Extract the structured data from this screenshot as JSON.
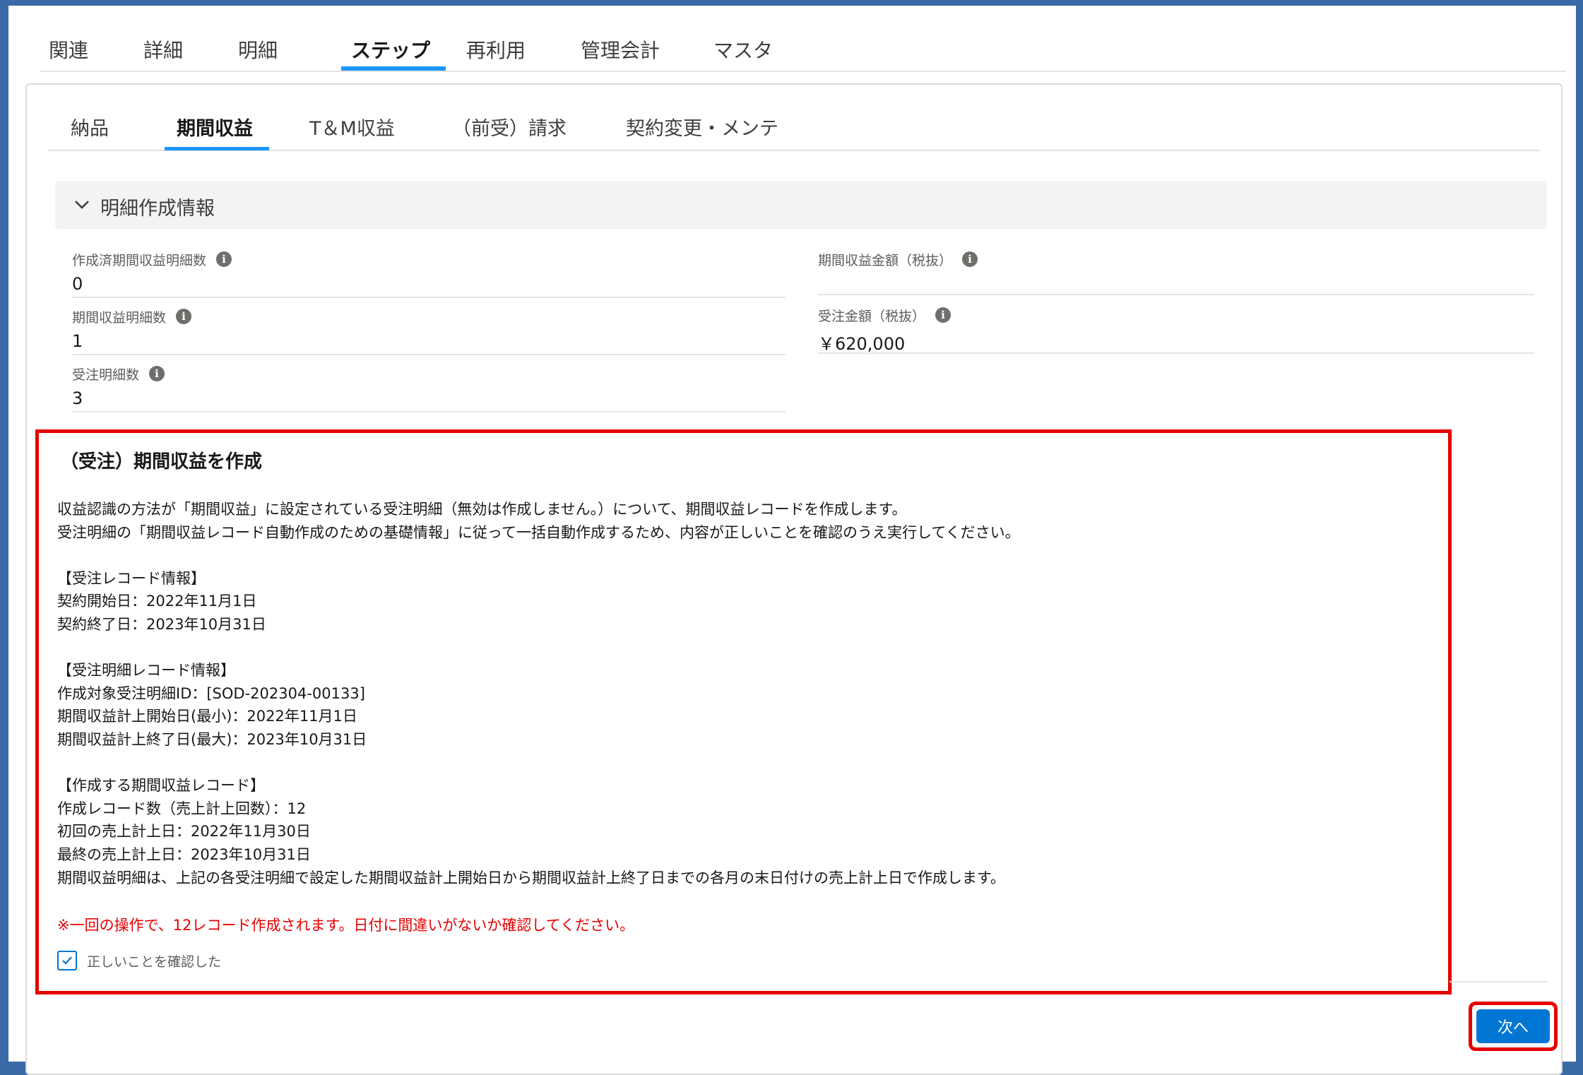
{
  "top_tabs": [
    {
      "label": "関連"
    },
    {
      "label": "詳細"
    },
    {
      "label": "明細"
    },
    {
      "label": "ステップ"
    },
    {
      "label": "再利用"
    },
    {
      "label": "管理会計"
    },
    {
      "label": "マスタ"
    }
  ],
  "sub_tabs": [
    {
      "label": "納品"
    },
    {
      "label": "期間収益"
    },
    {
      "label": "T＆M収益"
    },
    {
      "label": "（前受）請求"
    },
    {
      "label": "契約変更・メンテ"
    }
  ],
  "section": {
    "title": "明細作成情報",
    "icon": "chevron-down-icon"
  },
  "fields_left": [
    {
      "label": "作成済期間収益明細数",
      "value": "0"
    },
    {
      "label": "期間収益明細数",
      "value": "1"
    },
    {
      "label": "受注明細数",
      "value": "3"
    }
  ],
  "fields_right": [
    {
      "label": "期間収益金額（税抜）",
      "value": ""
    },
    {
      "label": "受注金額（税抜）",
      "value": "￥620,000"
    }
  ],
  "instruction": {
    "title": "（受注）期間収益を作成",
    "body": "収益認識の方法が「期間収益」に設定されている受注明細（無効は作成しません。）について、期間収益レコードを作成します。\n受注明細の「期間収益レコード自動作成のための基礎情報」に従って一括自動作成するため、内容が正しいことを確認のうえ実行してください。\n\n【受注レコード情報】\n契約開始日：2022年11月1日\n契約終了日：2023年10月31日\n\n【受注明細レコード情報】\n作成対象受注明細ID：[SOD-202304-00133]\n期間収益計上開始日(最小)：2022年11月1日\n期間収益計上終了日(最大)：2023年10月31日\n\n【作成する期間収益レコード】\n作成レコード数（売上計上回数）：12\n初回の売上計上日：2022年11月30日\n最終の売上計上日：2023年10月31日\n期間収益明細は、上記の各受注明細で設定した期間収益計上開始日から期間収益計上終了日までの各月の末日付けの売上計上日で作成します。",
    "warning": "※一回の操作で、12レコード作成されます。日付に間違いがないか確認してください。",
    "confirm_label": "正しいことを確認した",
    "confirm_checked": true
  },
  "next_button": {
    "label": "次へ"
  },
  "colors": {
    "accent": "#1b96ff",
    "button": "#0176d3",
    "highlight": "#e60000"
  }
}
